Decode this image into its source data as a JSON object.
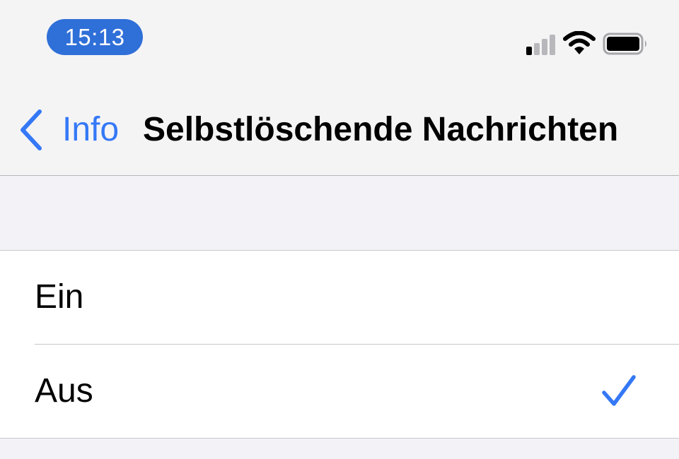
{
  "status_bar": {
    "time": "15:13",
    "icons": [
      "cellular-signal-icon",
      "wifi-icon",
      "battery-icon"
    ]
  },
  "nav": {
    "back_label": "Info",
    "back_icon": "chevron-left-icon",
    "title": "Selbstlöschende Nachrichten"
  },
  "options": [
    {
      "label": "Ein",
      "selected": false
    },
    {
      "label": "Aus",
      "selected": true
    }
  ],
  "colors": {
    "accent": "#3478f6",
    "time_pill": "#2f6fd8",
    "grouped_background": "#f2f2f7",
    "bar_background": "#f4f4f5"
  }
}
